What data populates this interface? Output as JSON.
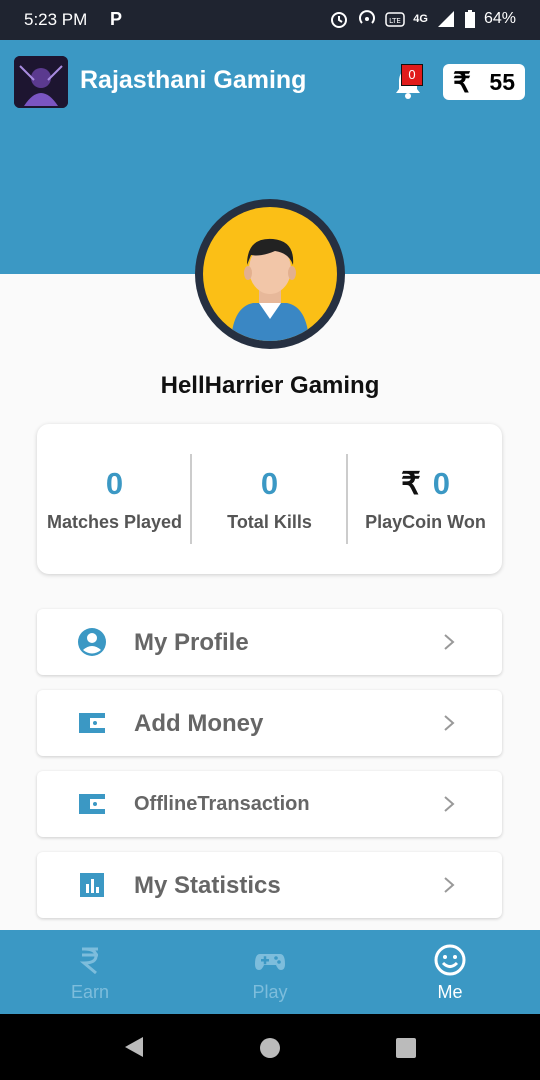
{
  "status_bar": {
    "time": "5:23 PM",
    "app_badge": "P",
    "network": "4G",
    "battery": "64%",
    "icons": [
      "alarm-icon",
      "hotspot-icon",
      "volte-icon",
      "signal-icon",
      "battery-icon"
    ]
  },
  "header": {
    "title": "Rajasthani Gaming",
    "notification_count": "0",
    "wallet_symbol": "₹",
    "wallet_amount": "55",
    "colors": {
      "primary": "#3b98c4",
      "badge": "#e01b1b"
    }
  },
  "profile": {
    "username": "HellHarrier Gaming"
  },
  "stats": [
    {
      "value": "0",
      "label": "Matches Played",
      "prefix": ""
    },
    {
      "value": "0",
      "label": "Total Kills",
      "prefix": ""
    },
    {
      "value": "0",
      "label": "PlayCoin Won",
      "prefix": "₹"
    }
  ],
  "menu": [
    {
      "label": "My Profile",
      "icon": "account-circle-icon"
    },
    {
      "label": "Add Money",
      "icon": "wallet-icon"
    },
    {
      "label": "OfflineTransaction",
      "icon": "wallet-icon"
    },
    {
      "label": "My Statistics",
      "icon": "bar-chart-icon"
    }
  ],
  "bottom_nav": [
    {
      "label": "Earn",
      "icon": "rupee-icon",
      "active": false
    },
    {
      "label": "Play",
      "icon": "gamepad-icon",
      "active": false
    },
    {
      "label": "Me",
      "icon": "smiley-icon",
      "active": true
    }
  ]
}
